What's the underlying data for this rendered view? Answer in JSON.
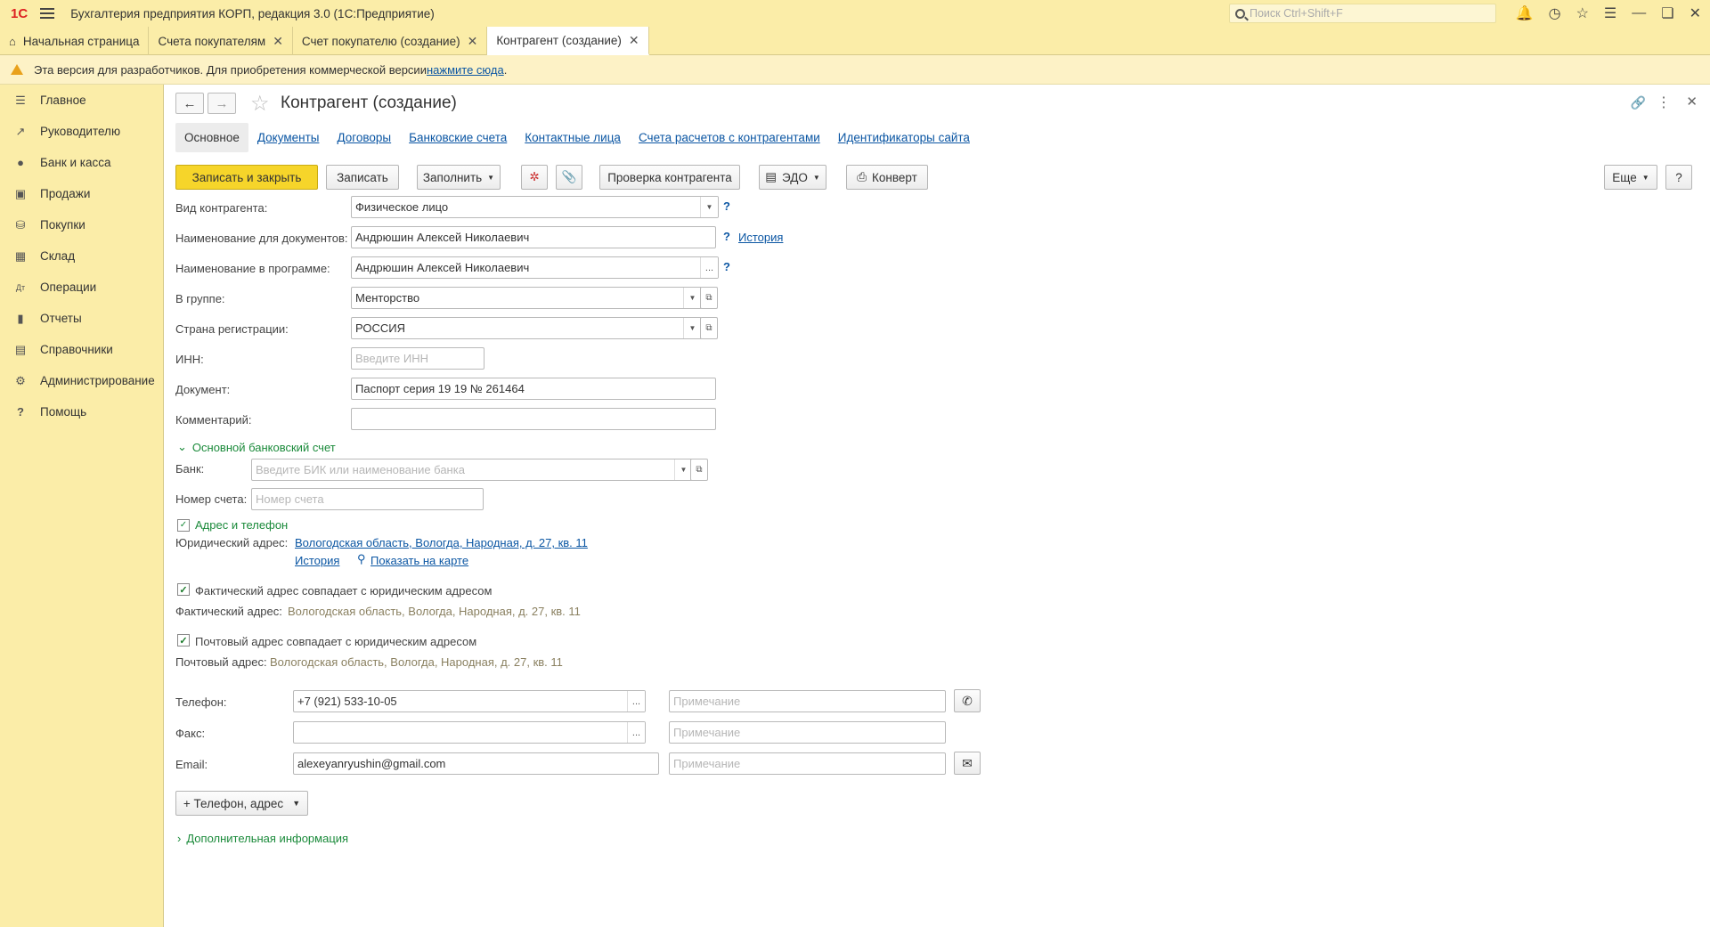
{
  "app": {
    "logo": "1С",
    "title": "Бухгалтерия предприятия КОРП, редакция 3.0  (1С:Предприятие)",
    "search_placeholder": "Поиск Ctrl+Shift+F"
  },
  "tabs": [
    {
      "label": "Начальная страница"
    },
    {
      "label": "Счета покупателям"
    },
    {
      "label": "Счет покупателю (создание)"
    },
    {
      "label": "Контрагент (создание)"
    }
  ],
  "warning": {
    "text": "Эта версия для разработчиков. Для приобретения коммерческой версии ",
    "link": "нажмите сюда",
    "tail": "."
  },
  "sidebar": {
    "items": [
      {
        "label": "Главное",
        "icon": "menu-icon"
      },
      {
        "label": "Руководителю",
        "icon": "chart-trend-icon"
      },
      {
        "label": "Банк и касса",
        "icon": "ruble-icon"
      },
      {
        "label": "Продажи",
        "icon": "bag-icon"
      },
      {
        "label": "Покупки",
        "icon": "cart-icon"
      },
      {
        "label": "Склад",
        "icon": "grid-icon"
      },
      {
        "label": "Операции",
        "icon": "dt-kt-icon"
      },
      {
        "label": "Отчеты",
        "icon": "bar-chart-icon"
      },
      {
        "label": "Справочники",
        "icon": "books-icon"
      },
      {
        "label": "Администрирование",
        "icon": "gear-icon"
      },
      {
        "label": "Помощь",
        "icon": "question-icon"
      }
    ]
  },
  "form": {
    "title": "Контрагент (создание)",
    "subtabs": [
      "Основное",
      "Документы",
      "Договоры",
      "Банковские счета",
      "Контактные лица",
      "Счета расчетов с контрагентами",
      "Идентификаторы сайта"
    ],
    "toolbar": {
      "save_close": "Записать и закрыть",
      "save": "Записать",
      "fill": "Заполнить",
      "check": "Проверка контрагента",
      "edo": "ЭДО",
      "envelope": "Конверт",
      "more": "Еще",
      "help": "?"
    },
    "fields": {
      "kind_label": "Вид контрагента:",
      "kind_value": "Физическое лицо",
      "docname_label": "Наименование для документов:",
      "docname_value": "Андрюшин Алексей Николаевич",
      "history_link": "История",
      "progname_label": "Наименование в программе:",
      "progname_value": "Андрюшин Алексей Николаевич",
      "group_label": "В группе:",
      "group_value": "Менторство",
      "country_label": "Страна регистрации:",
      "country_value": "РОССИЯ",
      "inn_label": "ИНН:",
      "inn_placeholder": "Введите ИНН",
      "doc_label": "Документ:",
      "doc_value": "Паспорт серия 19 19 № 261464",
      "comment_label": "Комментарий:",
      "comment_value": ""
    },
    "bank": {
      "section": "Основной банковский счет",
      "bank_label": "Банк:",
      "bank_placeholder": "Введите БИК или наименование банка",
      "account_label": "Номер счета:",
      "account_placeholder": "Номер счета"
    },
    "address": {
      "section": "Адрес и телефон",
      "legal_label": "Юридический адрес:",
      "legal_value": "Вологодская область, Вологда, Народная, д. 27, кв. 11",
      "history_link": "История",
      "map_link": "Показать на карте",
      "actual_same": "Фактический адрес совпадает с юридическим адресом",
      "actual_label": "Фактический адрес:",
      "actual_value": "Вологодская область, Вологда, Народная, д. 27, кв. 11",
      "postal_same": "Почтовый адрес совпадает с юридическим адресом",
      "postal_label": "Почтовый адрес:",
      "postal_value": "Вологодская область, Вологда, Народная, д. 27, кв. 11"
    },
    "contacts": {
      "phone_label": "Телефон:",
      "phone_value": "+7 (921) 533-10-05",
      "fax_label": "Факс:",
      "fax_value": "",
      "email_label": "Email:",
      "email_value": "alexeyanryushin@gmail.com",
      "note_placeholder": "Примечание",
      "add_button": "+ Телефон, адрес"
    },
    "extra_section": "Дополнительная информация"
  }
}
